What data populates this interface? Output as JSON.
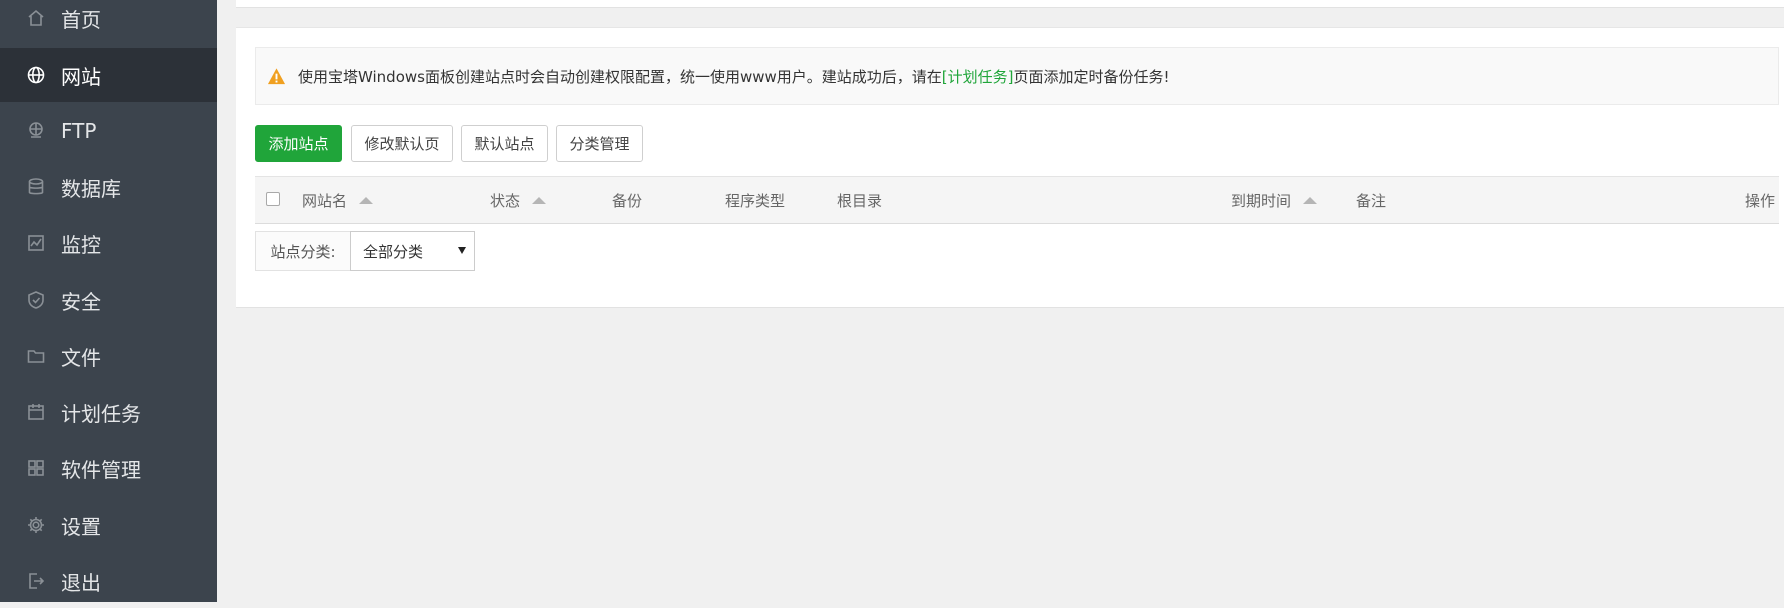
{
  "sidebar": {
    "items": [
      {
        "label": "首页",
        "icon": "home-icon"
      },
      {
        "label": "网站",
        "icon": "globe-icon"
      },
      {
        "label": "FTP",
        "icon": "ftp-icon"
      },
      {
        "label": "数据库",
        "icon": "database-icon"
      },
      {
        "label": "监控",
        "icon": "monitor-icon"
      },
      {
        "label": "安全",
        "icon": "shield-icon"
      },
      {
        "label": "文件",
        "icon": "folder-icon"
      },
      {
        "label": "计划任务",
        "icon": "calendar-icon"
      },
      {
        "label": "软件管理",
        "icon": "apps-icon"
      },
      {
        "label": "设置",
        "icon": "gear-icon"
      },
      {
        "label": "退出",
        "icon": "logout-icon"
      }
    ],
    "active_index": 1
  },
  "notice": {
    "text_before": "使用宝塔Windows面板创建站点时会自动创建权限配置，统一使用www用户。建站成功后，请在",
    "link": "[计划任务]",
    "text_after": "页面添加定时备份任务!",
    "icon": "warning-icon"
  },
  "toolbar": {
    "add_site": "添加站点",
    "edit_default_page": "修改默认页",
    "default_site": "默认站点",
    "category_manage": "分类管理"
  },
  "table": {
    "columns": {
      "site_name": "网站名",
      "status": "状态",
      "backup": "备份",
      "program_type": "程序类型",
      "root_dir": "根目录",
      "expire_time": "到期时间",
      "remark": "备注",
      "action": "操作"
    }
  },
  "filter": {
    "label": "站点分类:",
    "selected": "全部分类"
  },
  "colors": {
    "sidebar_bg": "#3c444d",
    "sidebar_active_bg": "#2c3138",
    "primary": "#20a53a",
    "warning": "#f0a020"
  }
}
